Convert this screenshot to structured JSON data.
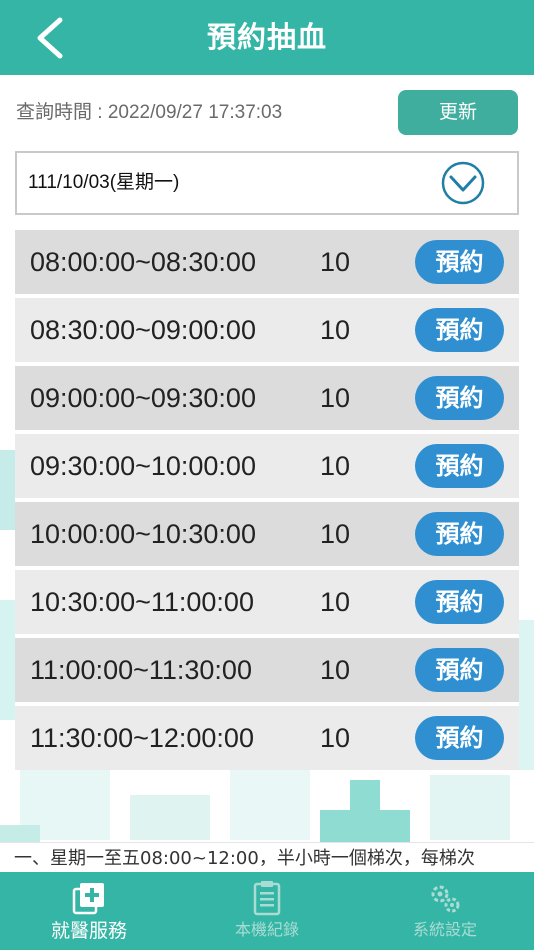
{
  "header": {
    "title": "預約抽血"
  },
  "query": {
    "label": "查詢時間 : 2022/09/27 17:37:03",
    "refresh_label": "更新"
  },
  "date_select": {
    "value": "111/10/03(星期一)"
  },
  "slots": [
    {
      "time": "08:00:00~08:30:00",
      "count": "10",
      "action": "預約"
    },
    {
      "time": "08:30:00~09:00:00",
      "count": "10",
      "action": "預約"
    },
    {
      "time": "09:00:00~09:30:00",
      "count": "10",
      "action": "預約"
    },
    {
      "time": "09:30:00~10:00:00",
      "count": "10",
      "action": "預約"
    },
    {
      "time": "10:00:00~10:30:00",
      "count": "10",
      "action": "預約"
    },
    {
      "time": "10:30:00~11:00:00",
      "count": "10",
      "action": "預約"
    },
    {
      "time": "11:00:00~11:30:00",
      "count": "10",
      "action": "預約"
    },
    {
      "time": "11:30:00~12:00:00",
      "count": "10",
      "action": "預約"
    }
  ],
  "notice": {
    "text": "一、星期一至五08:00~12:00，半小時一個梯次，每梯次"
  },
  "nav": {
    "items": [
      {
        "label": "就醫服務",
        "icon": "medical-cross-icon",
        "active": true
      },
      {
        "label": "本機紀錄",
        "icon": "record-list-icon",
        "active": false
      },
      {
        "label": "系統設定",
        "icon": "gears-icon",
        "active": false
      }
    ]
  },
  "colors": {
    "primary": "#35b5a5",
    "button_blue": "#2f8fd1",
    "refresh": "#3fae9f"
  }
}
